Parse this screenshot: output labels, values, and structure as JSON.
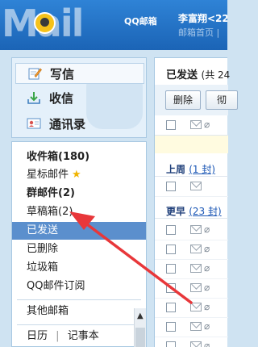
{
  "header": {
    "logo_text": "Mail",
    "logo_product": "QQ邮箱",
    "user_name": "李富翔<22",
    "links": "邮箱首页 |"
  },
  "nav": {
    "compose": "写信",
    "inbox": "收信",
    "contacts": "通讯录"
  },
  "folders": {
    "inbox": "收件箱(180)",
    "starred": "星标邮件",
    "groups": "群邮件(2)",
    "drafts": "草稿箱(2)",
    "sent": "已发送",
    "deleted": "已删除",
    "spam": "垃圾箱",
    "subscriptions": "QQ邮件订阅",
    "other": "其他邮箱",
    "calendar": "日历",
    "notepad": "记事本",
    "calendar_sep": "|"
  },
  "main": {
    "title": "已发送",
    "title_count": "(共 24",
    "toolbar": {
      "delete": "删除",
      "more": "彻"
    },
    "groups": [
      {
        "label": "上周",
        "count_link": "(1 封)"
      },
      {
        "label": "更早",
        "count_link": "(23 封)"
      }
    ]
  },
  "icons": {
    "compose": "pencil-note-icon",
    "inbox": "download-tray-icon",
    "contacts": "address-card-icon",
    "star": "star-icon",
    "mail": "envelope-icon",
    "attachment": "paperclip-icon"
  },
  "colors": {
    "header": "#1b64b6",
    "selected": "#5b8fcd",
    "star": "#f0b400",
    "annotation_arrow": "#e8373a"
  }
}
